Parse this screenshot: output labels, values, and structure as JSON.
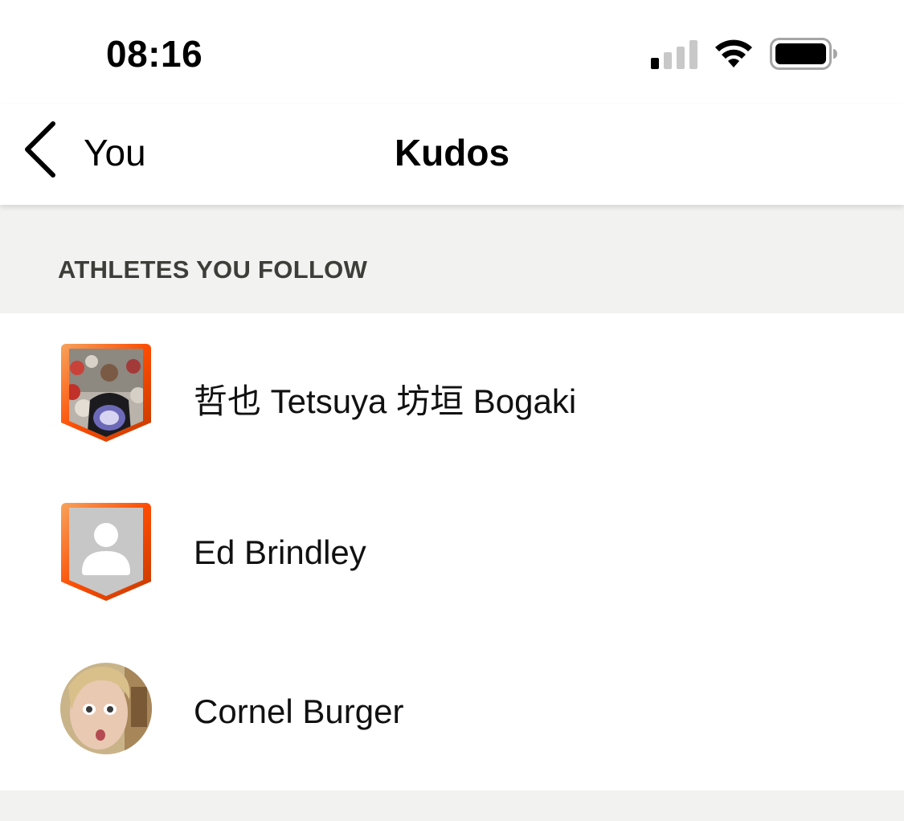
{
  "status_bar": {
    "time": "08:16",
    "signal_icon": "cellular-signal-icon",
    "wifi_icon": "wifi-icon",
    "battery_icon": "battery-icon"
  },
  "nav": {
    "back_label": "You",
    "back_icon": "chevron-left-icon",
    "title": "Kudos"
  },
  "section": {
    "title": "ATHLETES YOU FOLLOW"
  },
  "athletes": [
    {
      "name": "哲也 Tetsuya 坊垣 Bogaki",
      "avatar": "shield-photo-avatar"
    },
    {
      "name": "Ed Brindley",
      "avatar": "shield-placeholder-avatar"
    },
    {
      "name": "Cornel Burger",
      "avatar": "round-photo-avatar"
    }
  ],
  "colors": {
    "accent_orange": "#fc4c02",
    "section_bg": "#f2f2f0",
    "section_text": "#3d3d3a"
  }
}
